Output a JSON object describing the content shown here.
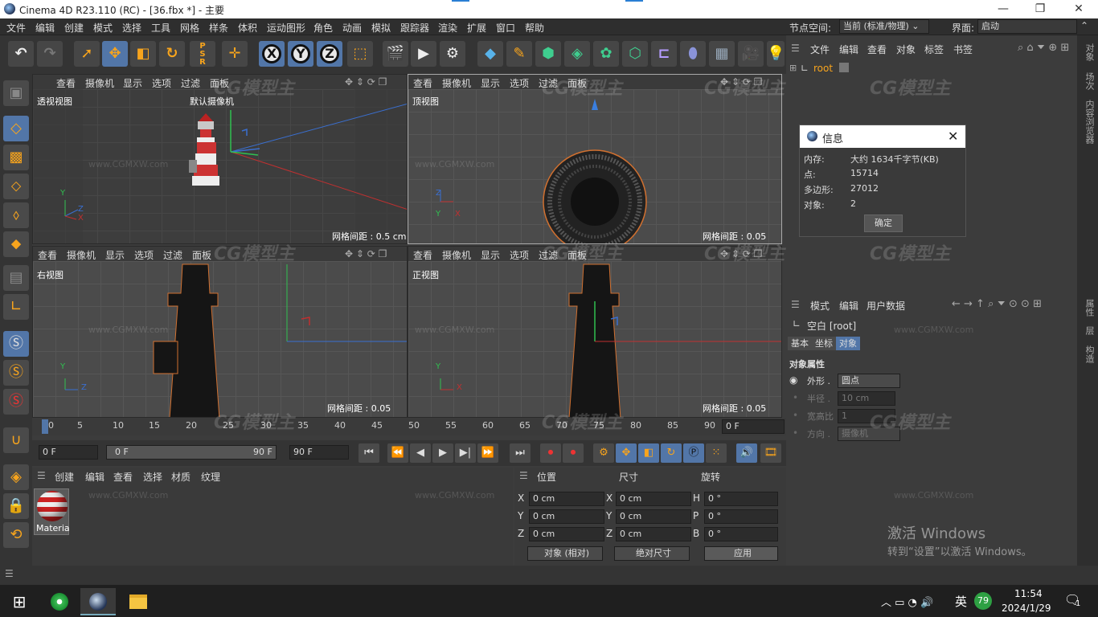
{
  "window": {
    "title": "Cinema 4D R23.110 (RC) - [36.fbx *] - 主要",
    "min": "—",
    "max": "❐",
    "close": "✕"
  },
  "menu": [
    "文件",
    "编辑",
    "创建",
    "模式",
    "选择",
    "工具",
    "网格",
    "样条",
    "体积",
    "运动图形",
    "角色",
    "动画",
    "模拟",
    "跟踪器",
    "渲染",
    "扩展",
    "窗口",
    "帮助"
  ],
  "nodespace": {
    "label": "节点空间:",
    "value": "当前 (标准/物理)"
  },
  "layout": {
    "label": "界面:",
    "value": "启动"
  },
  "viewport_menu": [
    "查看",
    "摄像机",
    "显示",
    "选项",
    "过滤",
    "面板"
  ],
  "viewports": {
    "persp": {
      "name": "透视视图",
      "camera": "默认摄像机",
      "grid": "网格间距 : 0.5 cm"
    },
    "top": {
      "name": "顶视图",
      "grid": "网格间距 : 0.05 cm"
    },
    "right": {
      "name": "右视图",
      "grid": "网格间距 : 0.05 cm"
    },
    "front": {
      "name": "正视图",
      "grid": "网格间距 : 0.05 cm"
    }
  },
  "axis": {
    "x": "X",
    "y": "Y",
    "z": "Z"
  },
  "timeline": {
    "ticks": [
      "0",
      "5",
      "10",
      "15",
      "20",
      "25",
      "30",
      "35",
      "40",
      "45",
      "50",
      "55",
      "60",
      "65",
      "70",
      "75",
      "80",
      "85",
      "90"
    ],
    "current": "0 F"
  },
  "transport": {
    "start": "0 F",
    "range_start": "0 F",
    "range_end": "90 F",
    "end": "90 F"
  },
  "material_menu": [
    "创建",
    "编辑",
    "查看",
    "选择",
    "材质",
    "纹理"
  ],
  "material": {
    "name": "Materia"
  },
  "coords": {
    "headers": [
      "位置",
      "尺寸",
      "旋转"
    ],
    "rows": [
      {
        "a": "X",
        "pos": "0 cm",
        "b": "X",
        "size": "0 cm",
        "c": "H",
        "rot": "0 °"
      },
      {
        "a": "Y",
        "pos": "0 cm",
        "b": "Y",
        "size": "0 cm",
        "c": "P",
        "rot": "0 °"
      },
      {
        "a": "Z",
        "pos": "0 cm",
        "b": "Z",
        "size": "0 cm",
        "c": "B",
        "rot": "0 °"
      }
    ],
    "mode": "对象 (相对)",
    "sizemode": "绝对尺寸",
    "apply": "应用"
  },
  "objmgr": {
    "menu": [
      "文件",
      "编辑",
      "查看",
      "对象",
      "标签",
      "书签"
    ],
    "root": "root"
  },
  "attrmgr": {
    "menu": [
      "模式",
      "编辑",
      "用户数据"
    ],
    "object": "空白 [root]",
    "tabs": [
      "基本",
      "坐标",
      "对象"
    ],
    "section": "对象属性",
    "props": [
      {
        "label": "外形 .",
        "value": "圆点"
      },
      {
        "label": "半径 .",
        "value": "10 cm"
      },
      {
        "label": "宽高比",
        "value": "1"
      },
      {
        "label": "方向 .",
        "value": "摄像机"
      }
    ]
  },
  "rightstrip": [
    "对象",
    "场次",
    "内容浏览器",
    "属性",
    "层",
    "构造"
  ],
  "dialog": {
    "title": "信息",
    "rows": [
      {
        "k": "内存:",
        "v": "大约 1634千字节(KB)"
      },
      {
        "k": "点:",
        "v": "15714"
      },
      {
        "k": "多边形:",
        "v": "27012"
      },
      {
        "k": "对象:",
        "v": "2"
      }
    ],
    "ok": "确定"
  },
  "activation": {
    "line1": "激活 Windows",
    "line2": "转到“设置”以激活 Windows。"
  },
  "watermark": {
    "logo": "CG模型主",
    "url": "www.CGMXW.com"
  },
  "tray": {
    "ime": "英",
    "badge": "79",
    "time": "11:54",
    "date": "2024/1/29",
    "notif": "1"
  }
}
